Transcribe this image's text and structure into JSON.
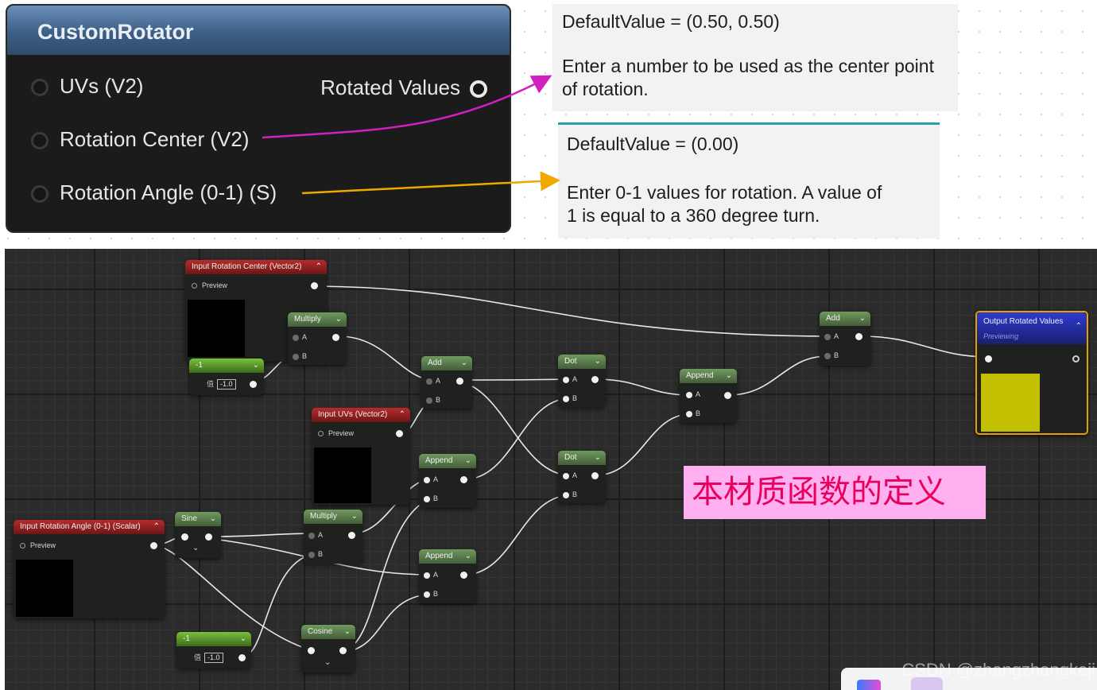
{
  "custom_rotator": {
    "title": "CustomRotator",
    "inputs": [
      "UVs (V2)",
      "Rotation Center (V2)",
      "Rotation Angle (0-1) (S)"
    ],
    "output": "Rotated Values"
  },
  "tooltips": {
    "center": {
      "default": "DefaultValue = (0.50, 0.50)",
      "desc_line1": "Enter a number to be used as the center point",
      "desc_line2": "of rotation."
    },
    "angle": {
      "default": "DefaultValue = (0.00)",
      "desc_line1": "Enter 0-1 values for rotation. A value of",
      "desc_line2": "1 is equal to a 360 degree turn."
    }
  },
  "graph": {
    "input_rotation_center": {
      "title": "Input Rotation Center (Vector2)",
      "preview": "Preview"
    },
    "input_uvs": {
      "title": "Input UVs (Vector2)",
      "preview": "Preview"
    },
    "input_rotation_angle": {
      "title": "Input Rotation Angle (0-1) (Scalar)",
      "preview": "Preview"
    },
    "constant_top": {
      "title": "-1",
      "label": "值",
      "value": "-1.0"
    },
    "constant_bottom": {
      "title": "-1",
      "label": "值",
      "value": "-1.0"
    },
    "multiply_top": {
      "title": "Multiply",
      "a": "A",
      "b": "B"
    },
    "multiply_mid": {
      "title": "Multiply",
      "a": "A",
      "b": "B"
    },
    "add_left": {
      "title": "Add",
      "a": "A",
      "b": "B"
    },
    "add_right": {
      "title": "Add",
      "a": "A",
      "b": "B"
    },
    "dot_top": {
      "title": "Dot",
      "a": "A",
      "b": "B"
    },
    "dot_bottom": {
      "title": "Dot",
      "a": "A",
      "b": "B"
    },
    "append_top": {
      "title": "Append",
      "a": "A",
      "b": "B"
    },
    "append_bottom": {
      "title": "Append",
      "a": "A",
      "b": "B"
    },
    "append_right": {
      "title": "Append",
      "a": "A",
      "b": "B"
    },
    "sine": {
      "title": "Sine"
    },
    "cosine": {
      "title": "Cosine"
    },
    "output": {
      "title": "Output Rotated Values",
      "status": "Previewing",
      "swatch_color": "#c2c000",
      "border_color": "#e3a000"
    }
  },
  "callout": {
    "text": "本材质函数的定义",
    "bg": "#ffb0f0",
    "color": "#e8005c"
  },
  "watermark": "CSDN @zhangzhangkeji",
  "colors": {
    "arrow_center": "#d020c0",
    "arrow_angle": "#f0a800",
    "tooltip_rule": "#2aa0a6"
  }
}
